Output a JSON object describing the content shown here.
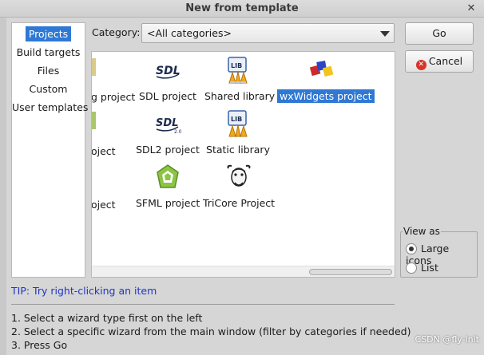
{
  "window": {
    "title": "New from template",
    "close": "✕"
  },
  "nav": {
    "items": [
      {
        "label": "Projects",
        "selected": true
      },
      {
        "label": "Build targets",
        "selected": false
      },
      {
        "label": "Files",
        "selected": false
      },
      {
        "label": "Custom",
        "selected": false
      },
      {
        "label": "User templates",
        "selected": false
      }
    ]
  },
  "category": {
    "label": "Category:",
    "value": "<All categories>"
  },
  "tiles": [
    {
      "label": "g project",
      "icon": "project-icon"
    },
    {
      "label": "SDL project",
      "icon": "sdl-icon"
    },
    {
      "label": "Shared library",
      "icon": "shared-library-icon"
    },
    {
      "label": "wxWidgets project",
      "icon": "wxwidgets-icon",
      "selected": true
    },
    {
      "label": "oject",
      "icon": "project-icon"
    },
    {
      "label": "SDL2 project",
      "icon": "sdl2-icon"
    },
    {
      "label": "Static library",
      "icon": "static-library-icon"
    },
    {
      "label": "oject",
      "icon": "project-icon"
    },
    {
      "label": "SFML project",
      "icon": "sfml-icon"
    },
    {
      "label": "TriCore Project",
      "icon": "tricore-gnu-icon"
    }
  ],
  "buttons": {
    "go": "Go",
    "cancel": "Cancel"
  },
  "view_as": {
    "legend": "View as",
    "options": [
      "Large icons",
      "List"
    ],
    "selected": "Large icons"
  },
  "tip": "TIP: Try right-clicking an item",
  "help": [
    "1. Select a wizard type first on the left",
    "2. Select a specific wizard from the main window (filter by categories if needed)",
    "3. Press Go"
  ],
  "watermark": "CSDN @fly-init",
  "colors": {
    "selection": "#2f78d4",
    "tip": "#1f35c9",
    "cancel": "#d8342a"
  }
}
